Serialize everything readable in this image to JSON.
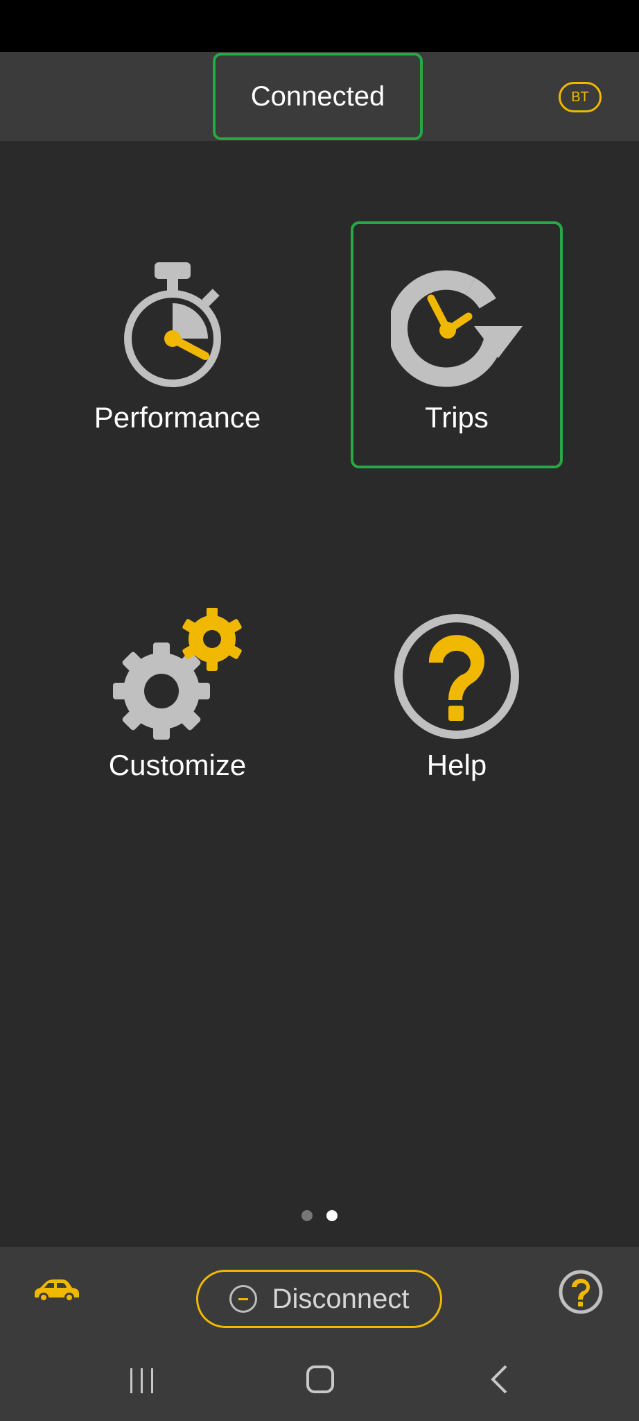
{
  "header": {
    "connection_status": "Connected",
    "bt_badge": "BT"
  },
  "tiles": [
    {
      "label": "Performance",
      "icon": "stopwatch-icon",
      "selected": false
    },
    {
      "label": "Trips",
      "icon": "trip-history-icon",
      "selected": true
    },
    {
      "label": "Customize",
      "icon": "gears-icon",
      "selected": false
    },
    {
      "label": "Help",
      "icon": "help-icon",
      "selected": false
    }
  ],
  "pagination": {
    "pages": 2,
    "current": 2
  },
  "bottom_bar": {
    "disconnect_label": "Disconnect",
    "left_icon": "car-icon",
    "right_icon": "help-icon"
  },
  "nav_bar": {
    "icons": [
      "recents-icon",
      "home-icon",
      "back-icon"
    ]
  },
  "colors": {
    "accent_yellow": "#f0b800",
    "selected_green": "#27a844",
    "icon_gray": "#c0c0c0",
    "background": "#2a2a2a",
    "bar": "#3b3b3b"
  }
}
